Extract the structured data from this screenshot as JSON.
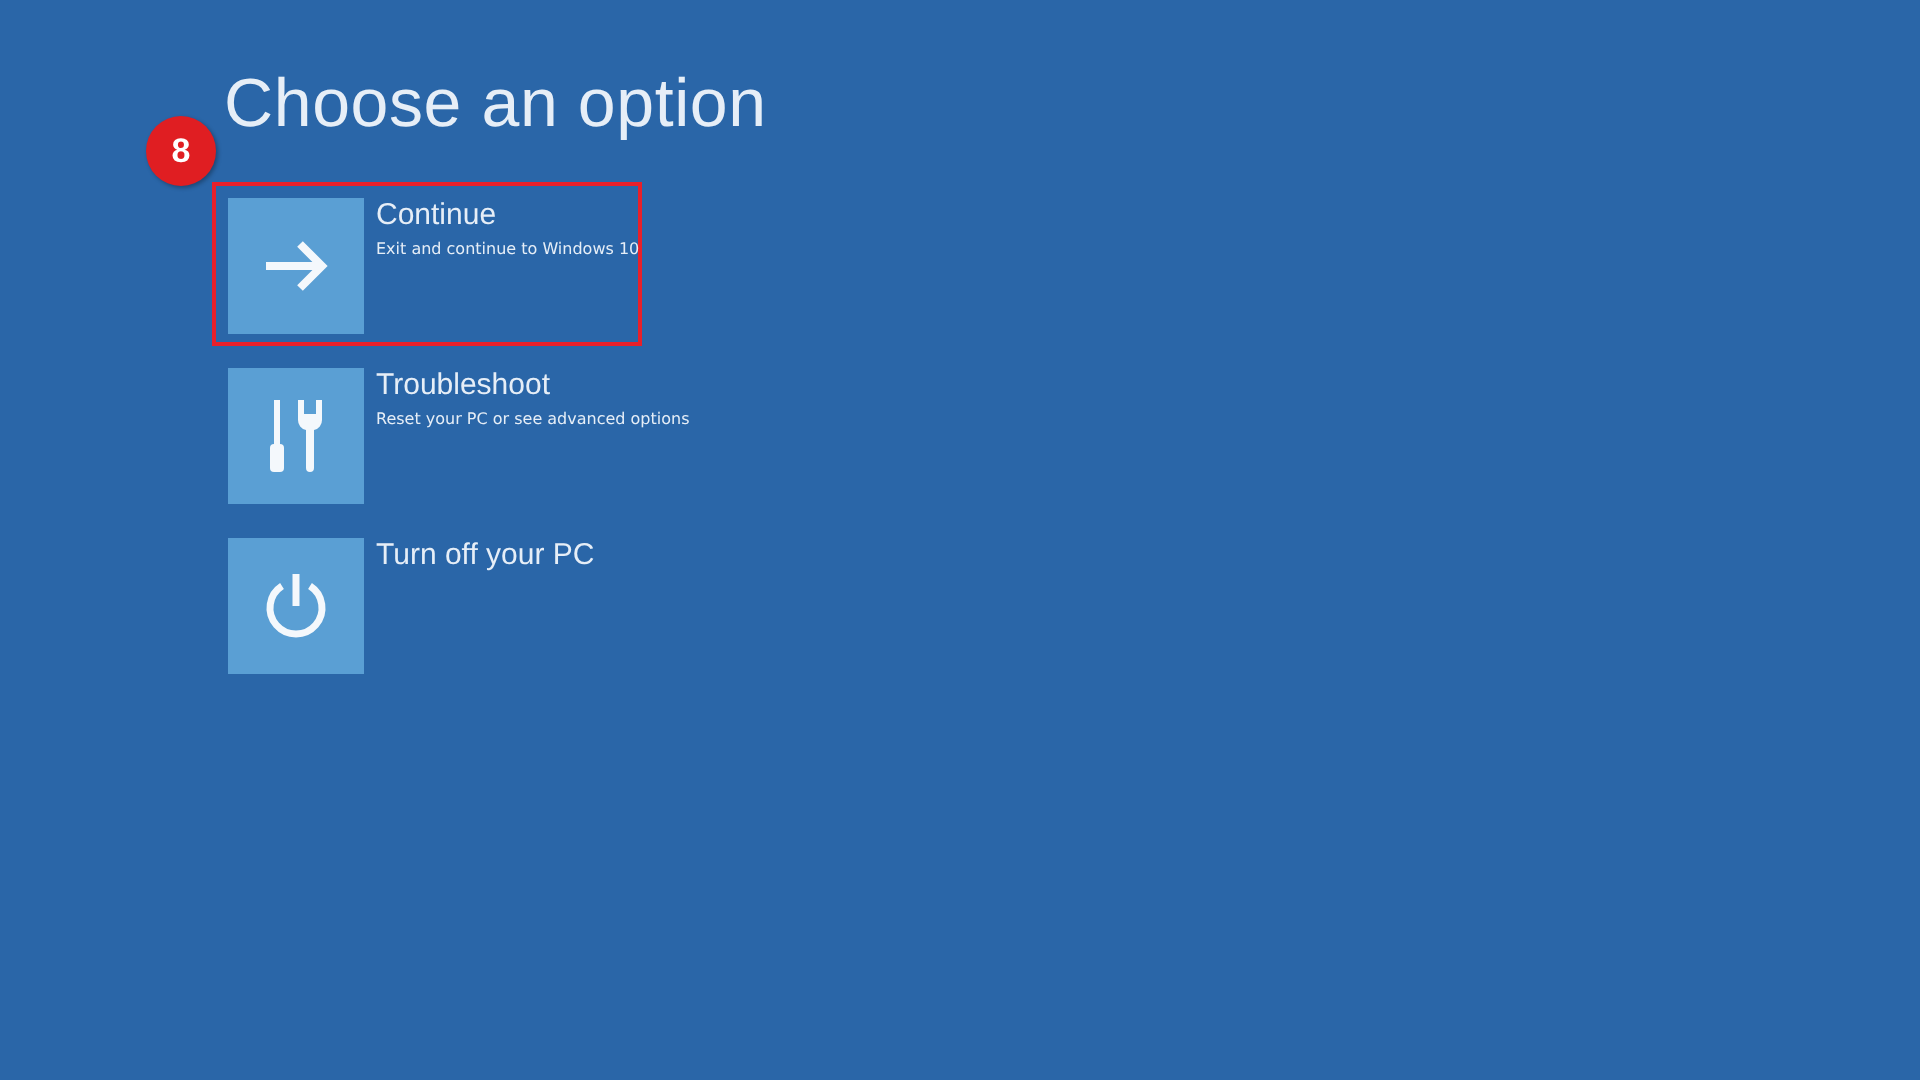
{
  "title": "Choose an option",
  "step_badge": "8",
  "options": [
    {
      "kind": "arrow",
      "label": "Continue",
      "description": "Exit and continue to Windows 10",
      "highlighted": true
    },
    {
      "kind": "tools",
      "label": "Troubleshoot",
      "description": "Reset your PC or see advanced options",
      "highlighted": false
    },
    {
      "kind": "power",
      "label": "Turn off your PC",
      "highlighted": false
    }
  ]
}
